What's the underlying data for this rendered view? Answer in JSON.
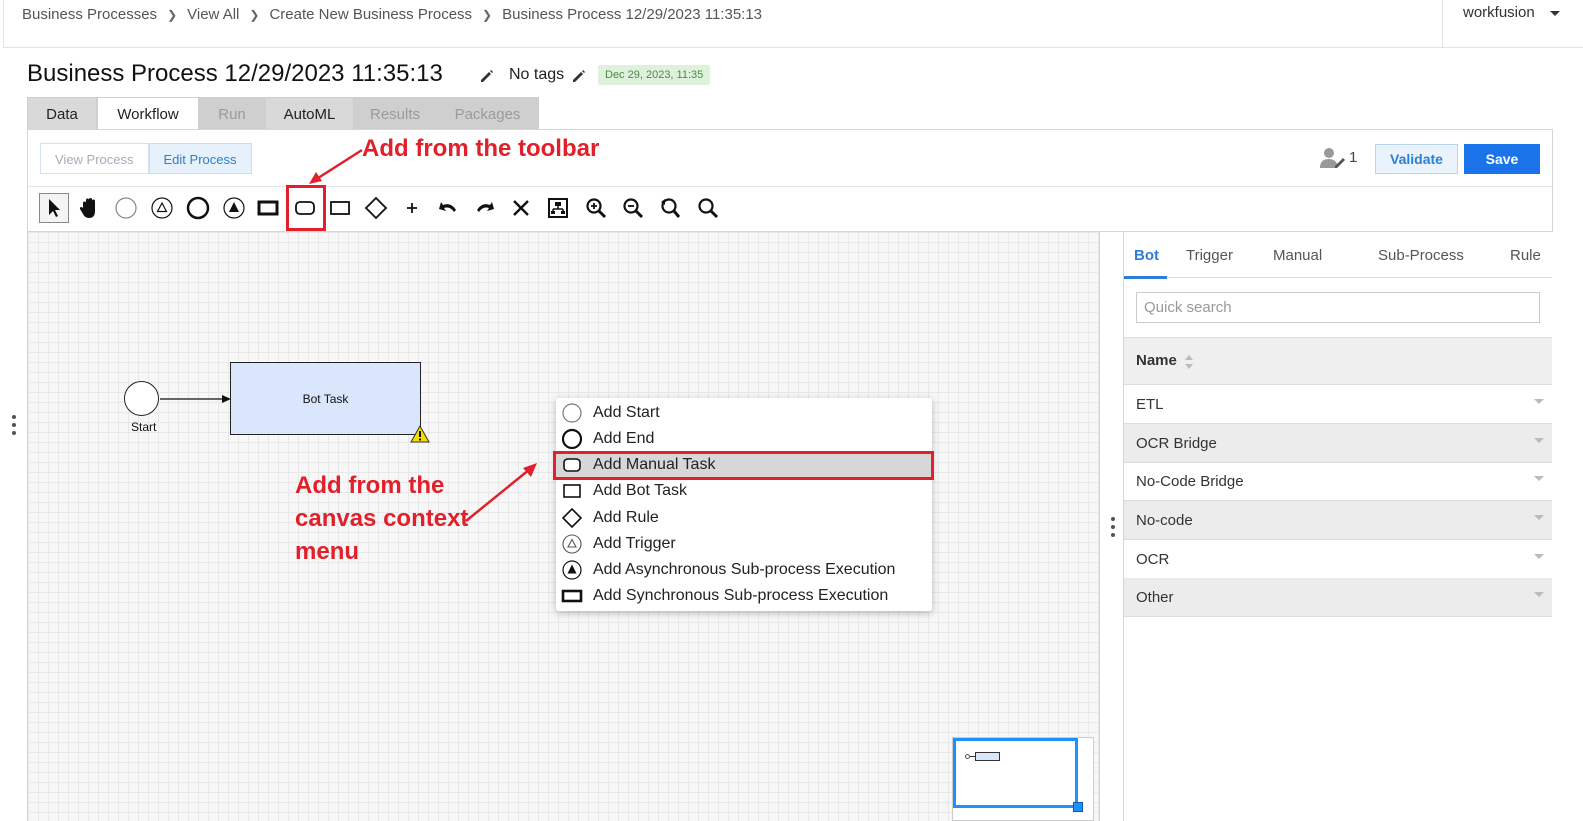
{
  "breadcrumb": [
    "Business Processes",
    "View All",
    "Create New Business Process",
    "Business Process 12/29/2023 11:35:13"
  ],
  "user": {
    "name": "workfusion"
  },
  "page": {
    "title": "Business Process 12/29/2023 11:35:13",
    "tags_label": "No tags",
    "date_badge": "Dec 29, 2023, 11:35"
  },
  "tabs": [
    {
      "label": "Data",
      "state": "enabled"
    },
    {
      "label": "Workflow",
      "state": "active"
    },
    {
      "label": "Run",
      "state": "disabled"
    },
    {
      "label": "AutoML",
      "state": "enabled"
    },
    {
      "label": "Results",
      "state": "disabled"
    },
    {
      "label": "Packages",
      "state": "disabled"
    }
  ],
  "mode": {
    "view_label": "View Process",
    "edit_label": "Edit Process",
    "active": "Edit Process"
  },
  "actions": {
    "collaborators_count": "1",
    "validate_label": "Validate",
    "save_label": "Save"
  },
  "toolbar_tools": [
    "pointer-icon",
    "hand-icon",
    "start-event-icon",
    "trigger-icon",
    "end-event-icon",
    "async-subprocess-icon",
    "sync-subprocess-icon",
    "manual-task-icon",
    "bot-task-icon",
    "rule-icon",
    "plus-icon",
    "undo-icon",
    "redo-icon",
    "delete-icon",
    "auto-layout-icon",
    "zoom-in-icon",
    "zoom-out-icon",
    "zoom-reset-icon",
    "zoom-fit-icon"
  ],
  "canvas": {
    "start_label": "Start",
    "bot_task_label": "Bot Task"
  },
  "annotations": {
    "toolbar": "Add from the toolbar",
    "canvas_lines": [
      "Add from the",
      "canvas context",
      "menu"
    ],
    "color": "#e0202b"
  },
  "context_menu": {
    "items": [
      {
        "label": "Add Start",
        "icon": "start-event-icon"
      },
      {
        "label": "Add End",
        "icon": "end-event-icon"
      },
      {
        "label": "Add Manual Task",
        "icon": "manual-task-icon",
        "highlighted": true
      },
      {
        "label": "Add Bot Task",
        "icon": "bot-task-icon"
      },
      {
        "label": "Add Rule",
        "icon": "rule-icon"
      },
      {
        "label": "Add Trigger",
        "icon": "trigger-icon"
      },
      {
        "label": "Add Asynchronous Sub-process Execution",
        "icon": "async-subprocess-icon"
      },
      {
        "label": "Add Synchronous Sub-process Execution",
        "icon": "sync-subprocess-icon"
      }
    ]
  },
  "right_panel": {
    "tabs": [
      "Bot",
      "Trigger",
      "Manual",
      "Sub-Process",
      "Rule"
    ],
    "active_tab": "Bot",
    "search_placeholder": "Quick search",
    "column_header": "Name",
    "categories": [
      "ETL",
      "OCR Bridge",
      "No-Code Bridge",
      "No-code",
      "OCR",
      "Other"
    ]
  },
  "colors": {
    "accent": "#1a73e8",
    "badge_bg": "#dff1dc",
    "badge_text": "#4a8a43",
    "bot_task_fill": "#dae6fc"
  }
}
